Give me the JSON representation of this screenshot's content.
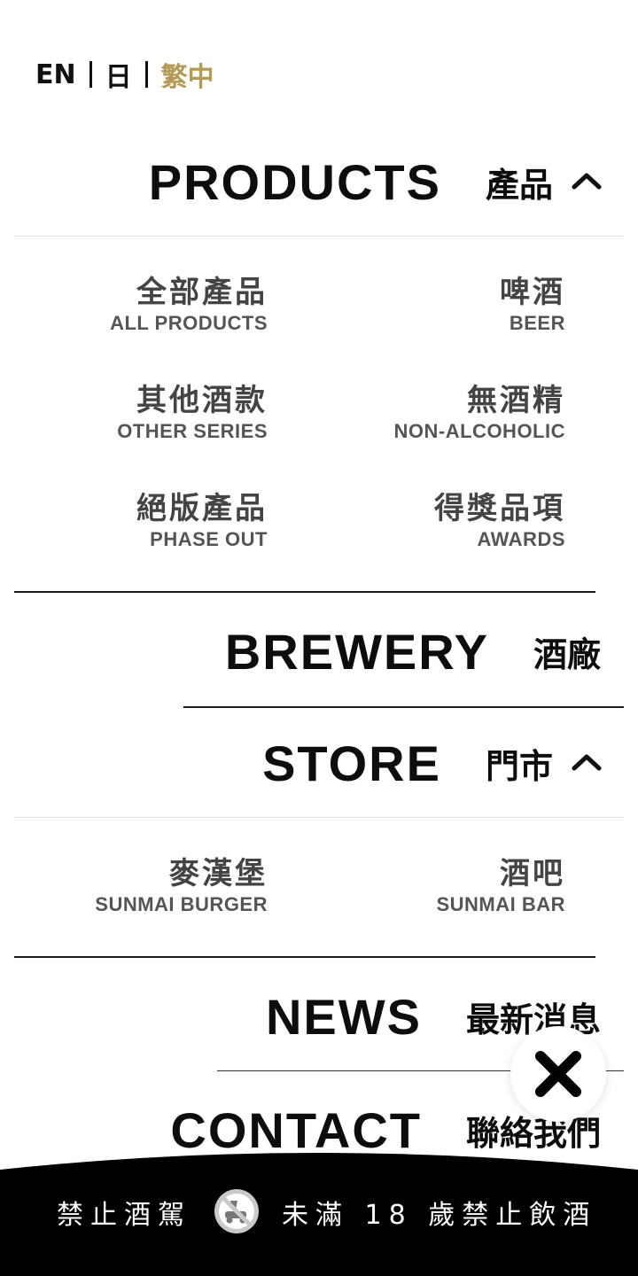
{
  "lang": {
    "en": "EN",
    "ja": "日",
    "zh": "繁中"
  },
  "menu": {
    "products": {
      "en": "PRODUCTS",
      "zh": "產品"
    },
    "brewery": {
      "en": "BREWERY",
      "zh": "酒廠"
    },
    "store": {
      "en": "STORE",
      "zh": "門市"
    },
    "news": {
      "en": "NEWS",
      "zh": "最新消息"
    },
    "contact": {
      "en": "CONTACT",
      "zh": "聯絡我們"
    }
  },
  "products_sub": [
    {
      "zh": "全部產品",
      "en": "ALL PRODUCTS"
    },
    {
      "zh": "啤酒",
      "en": "BEER"
    },
    {
      "zh": "其他酒款",
      "en": "OTHER SERIES"
    },
    {
      "zh": "無酒精",
      "en": "NON-ALCOHOLIC"
    },
    {
      "zh": "絕版產品",
      "en": "PHASE OUT"
    },
    {
      "zh": "得獎品項",
      "en": "AWARDS"
    }
  ],
  "store_sub": [
    {
      "zh": "麥漢堡",
      "en": "SUNMAI BURGER"
    },
    {
      "zh": "酒吧",
      "en": "SUNMAI BAR"
    }
  ],
  "footer": {
    "left": "禁止酒駕",
    "right": "未滿 18 歲禁止飲酒"
  },
  "icons": {
    "close": "close-icon",
    "chevron": "chevron-up-icon",
    "no-drink-drive": "no-drink-driving-icon"
  },
  "colors": {
    "accent": "#b39a55",
    "footer_bg": "#000000"
  }
}
